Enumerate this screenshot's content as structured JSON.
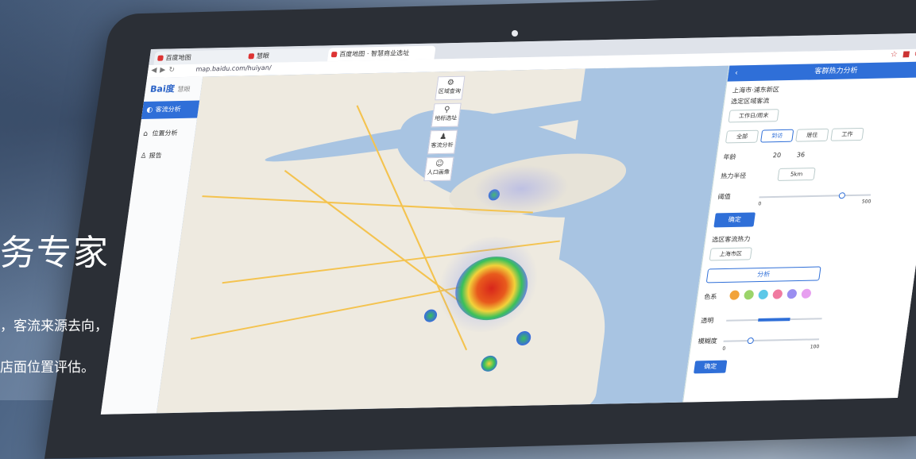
{
  "browser": {
    "tabs": [
      "百度地图",
      "慧眼",
      "百度地图 · 智慧商业选址"
    ],
    "url": "map.baidu.com/huiyan/"
  },
  "app": {
    "logo": "Bai度",
    "logo_suffix": "慧眼",
    "nav": [
      "客流分析",
      "位置分析",
      "报告"
    ]
  },
  "map_tools": [
    "区域查询",
    "地标选址",
    "客流分析",
    "人口画像"
  ],
  "panel": {
    "title": "客群热力分析",
    "location_line1": "上海市·浦东新区",
    "location_line2": "选定区域客流",
    "chip": "工作日/周末",
    "filters": [
      "全部",
      "到访",
      "居住",
      "工作"
    ],
    "age_label": "年龄",
    "age_from": "20",
    "age_to": "36",
    "range_label": "热力半径",
    "range_value": "5km",
    "threshold_label": "阈值",
    "threshold_min": "0",
    "threshold_max": "500",
    "confirm": "确定",
    "section_label": "选区客流热力",
    "section_chip": "上海市区",
    "analyze": "分析",
    "color_label": "色系",
    "opacity_label": "透明",
    "blur_label": "模糊度",
    "slider_min": "0",
    "slider_max": "100",
    "bottom_btn": "确定",
    "palette": [
      "#f2a33a",
      "#9bd46a",
      "#5cc8e8",
      "#f07aa0",
      "#9a8ef0",
      "#e79ff0"
    ]
  },
  "overlay": {
    "headline": "务专家",
    "line1": "，客流来源去向，",
    "line2": "店面位置评估。"
  }
}
